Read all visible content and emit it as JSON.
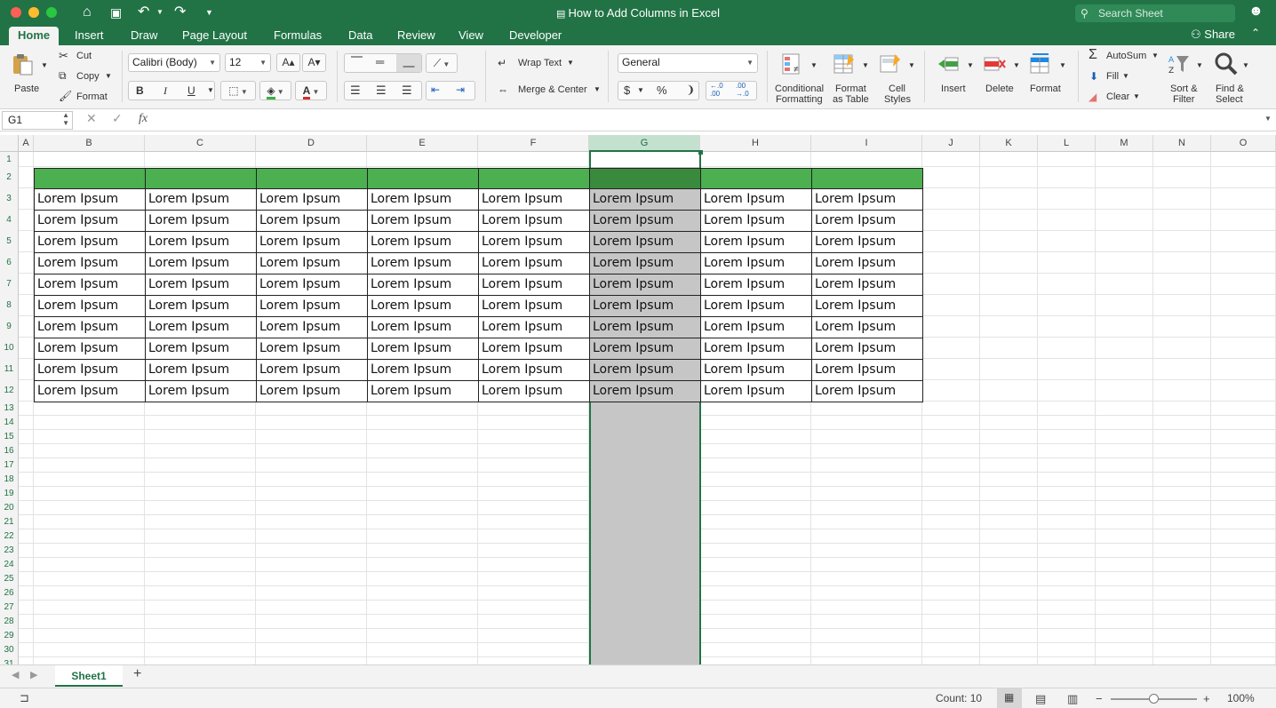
{
  "window": {
    "title": "How to Add Columns in Excel",
    "search_placeholder": "Search Sheet"
  },
  "tabs": [
    "Home",
    "Insert",
    "Draw",
    "Page Layout",
    "Formulas",
    "Data",
    "Review",
    "View",
    "Developer"
  ],
  "share_label": "Share",
  "ribbon": {
    "paste": "Paste",
    "cut": "Cut",
    "copy": "Copy",
    "format_painter": "Format",
    "font_name": "Calibri (Body)",
    "font_size": "12",
    "wrap_text": "Wrap Text",
    "merge_center": "Merge & Center",
    "number_format": "General",
    "conditional_formatting_1": "Conditional",
    "conditional_formatting_2": "Formatting",
    "format_as_table_1": "Format",
    "format_as_table_2": "as Table",
    "cell_styles_1": "Cell",
    "cell_styles_2": "Styles",
    "insert": "Insert",
    "delete": "Delete",
    "format": "Format",
    "autosum": "AutoSum",
    "fill": "Fill",
    "clear": "Clear",
    "sort_filter_1": "Sort &",
    "sort_filter_2": "Filter",
    "find_select_1": "Find &",
    "find_select_2": "Select",
    "bold": "B",
    "italic": "I",
    "underline": "U",
    "currency": "$",
    "percent": "%",
    "comma": "❩"
  },
  "formula_bar": {
    "name_box": "G1",
    "fx": "fx",
    "value": ""
  },
  "columns": [
    "A",
    "B",
    "C",
    "D",
    "E",
    "F",
    "G",
    "H",
    "I",
    "J",
    "K",
    "L",
    "M",
    "N",
    "O"
  ],
  "selected_column": "G",
  "rows": [
    "1",
    "2",
    "3",
    "4",
    "5",
    "6",
    "7",
    "8",
    "9",
    "10",
    "11",
    "12",
    "13",
    "14",
    "15",
    "16",
    "17",
    "18",
    "19",
    "20",
    "21",
    "22",
    "23",
    "24",
    "25",
    "26",
    "27",
    "28",
    "29",
    "30",
    "31"
  ],
  "table_cell_text": "Lorem Ipsum",
  "sheet_tabs": [
    "Sheet1"
  ],
  "add_sheet": "+",
  "status": {
    "count": "Count: 10",
    "zoom": "100%",
    "zoom_minus": "−",
    "zoom_plus": "+"
  },
  "colors": {
    "excel_green": "#217346",
    "header_fill": "#4caf50",
    "header_fill_selected": "#3a8a3d",
    "selection_fill": "#c6c6c6"
  }
}
